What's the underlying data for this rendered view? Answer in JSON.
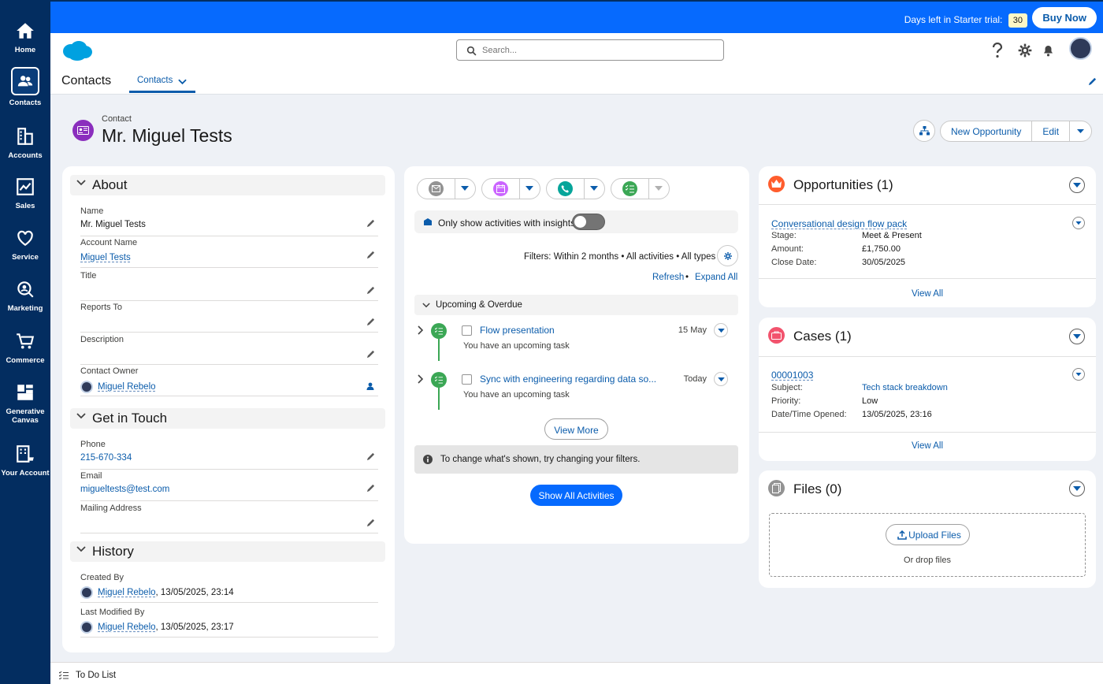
{
  "nav": {
    "home": "Home",
    "contacts": "Contacts",
    "accounts": "Accounts",
    "sales": "Sales",
    "service": "Service",
    "marketing": "Marketing",
    "commerce": "Commerce",
    "generative_canvas": "Generative Canvas",
    "your_account": "Your Account"
  },
  "banner": {
    "trial_text": "Days left in Starter trial:",
    "trial_days": "30",
    "buy_now": "Buy Now"
  },
  "header": {
    "search_placeholder": "Search...",
    "app_name": "Contacts",
    "tab_label": "Contacts"
  },
  "record": {
    "type": "Contact",
    "name": "Mr. Miguel Tests",
    "new_opportunity": "New Opportunity",
    "edit": "Edit"
  },
  "about": {
    "title": "About",
    "name_label": "Name",
    "name_value": "Mr. Miguel Tests",
    "account_label": "Account Name",
    "account_value": "Miguel Tests",
    "title_label": "Title",
    "reports_to_label": "Reports To",
    "description_label": "Description",
    "owner_label": "Contact Owner",
    "owner_value": "Miguel Rebelo"
  },
  "touch": {
    "title": "Get in Touch",
    "phone_label": "Phone",
    "phone_value": "215-670-334",
    "email_label": "Email",
    "email_value": "migueltests@test.com",
    "mailing_label": "Mailing Address"
  },
  "history": {
    "title": "History",
    "created_label": "Created By",
    "created_user": "Miguel Rebelo",
    "created_date": ", 13/05/2025, 23:14",
    "modified_label": "Last Modified By",
    "modified_user": "Miguel Rebelo",
    "modified_date": ", 13/05/2025, 23:17"
  },
  "activity": {
    "insights_label": "Only show activities with insights",
    "filters_text": "Filters: Within 2 months • All activities • All types",
    "refresh": "Refresh",
    "separator": "•",
    "expand_all": "Expand All",
    "upcoming_label": "Upcoming & Overdue",
    "tasks": [
      {
        "title": "Flow presentation",
        "subtitle": "You have an upcoming task",
        "date": "15 May"
      },
      {
        "title": "Sync with engineering regarding data so...",
        "subtitle": "You have an upcoming task",
        "date": "Today"
      }
    ],
    "view_more": "View More",
    "info_text": "To change what's shown, try changing your filters.",
    "show_all": "Show All Activities"
  },
  "opportunities": {
    "title": "Opportunities (1)",
    "item_name": "Conversational design flow pack",
    "stage_label": "Stage:",
    "stage_value": "Meet & Present",
    "amount_label": "Amount:",
    "amount_value": "£1,750.00",
    "close_label": "Close Date:",
    "close_value": "30/05/2025",
    "view_all": "View All"
  },
  "cases": {
    "title": "Cases (1)",
    "case_number": "00001003",
    "subject_label": "Subject:",
    "subject_value": "Tech stack breakdown",
    "priority_label": "Priority:",
    "priority_value": "Low",
    "opened_label": "Date/Time Opened:",
    "opened_value": "13/05/2025, 23:16",
    "view_all": "View All"
  },
  "files": {
    "title": "Files (0)",
    "upload": "Upload Files",
    "or_drop": "Or drop files"
  },
  "footer": {
    "todo": "To Do List"
  },
  "colors": {
    "nav_bg": "#032d60",
    "banner_bg": "#066afe",
    "link": "#0b5cab",
    "task_green": "#3ba755"
  }
}
